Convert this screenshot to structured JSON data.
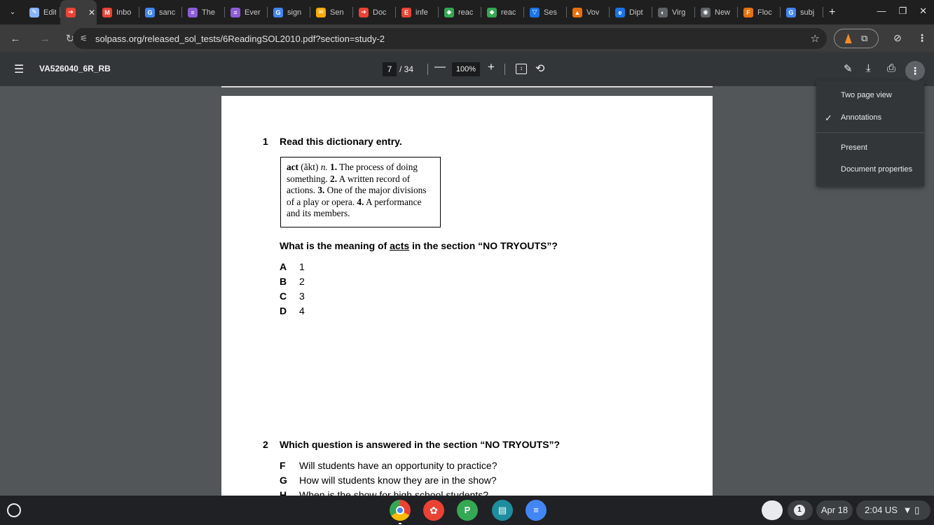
{
  "tabs": [
    {
      "label": "Edit",
      "fav_color": "#8ab4f8",
      "fav_text": "✎"
    },
    {
      "label": "",
      "fav_color": "#ea4335",
      "fav_text": "➔",
      "active": true
    },
    {
      "label": "Inbo",
      "fav_color": "#ea4335",
      "fav_text": "M"
    },
    {
      "label": "sanc",
      "fav_color": "#4285f4",
      "fav_text": "G"
    },
    {
      "label": "The",
      "fav_color": "#8e5cd9",
      "fav_text": "≡"
    },
    {
      "label": "Ever",
      "fav_color": "#8e5cd9",
      "fav_text": "≡"
    },
    {
      "label": "sign",
      "fav_color": "#4285f4",
      "fav_text": "G"
    },
    {
      "label": "Sen",
      "fav_color": "#f9ab00",
      "fav_text": "✉"
    },
    {
      "label": "Doc",
      "fav_color": "#ea4335",
      "fav_text": "➔"
    },
    {
      "label": "infe",
      "fav_color": "#ea4335",
      "fav_text": "E"
    },
    {
      "label": "reac",
      "fav_color": "#34a853",
      "fav_text": "◆"
    },
    {
      "label": "reac",
      "fav_color": "#34a853",
      "fav_text": "◆"
    },
    {
      "label": "Ses",
      "fav_color": "#1a73e8",
      "fav_text": "▽"
    },
    {
      "label": "Vov",
      "fav_color": "#e8710a",
      "fav_text": "▲"
    },
    {
      "label": "Dipt",
      "fav_color": "#1a73e8",
      "fav_text": "e"
    },
    {
      "label": "Virg",
      "fav_color": "#5f6368",
      "fav_text": "◐"
    },
    {
      "label": "New",
      "fav_color": "#5f6368",
      "fav_text": "◉"
    },
    {
      "label": "Floc",
      "fav_color": "#e8710a",
      "fav_text": "F"
    },
    {
      "label": "subj",
      "fav_color": "#4285f4",
      "fav_text": "G"
    }
  ],
  "address": {
    "url": "solpass.org/released_sol_tests/6ReadingSOL2010.pdf?section=study-2"
  },
  "pdf": {
    "title": "VA526040_6R_RB",
    "page_current": "7",
    "page_total": "/ 34",
    "zoom": "100%"
  },
  "menu": {
    "two_page_view": "Two page view",
    "annotations": "Annotations",
    "present": "Present",
    "document_properties": "Document properties"
  },
  "doc": {
    "q1_num": "1",
    "q1_text": "Read this dictionary entry.",
    "dict": {
      "word": "act",
      "pron": " (ăkt) ",
      "pos": "n.",
      "d1_num": " 1.",
      "d1": " The process of doing something.",
      "d2_num": " 2.",
      "d2": " A written record of actions.",
      "d3_num": " 3.",
      "d3": " One of the major divisions of a play or opera.",
      "d4_num": " 4.",
      "d4": " A performance and its members."
    },
    "q1b_pre": "What is the meaning of ",
    "q1b_word": "acts",
    "q1b_post": " in the section “NO TRYOUTS”?",
    "q1_options": [
      {
        "letter": "A",
        "text": "1"
      },
      {
        "letter": "B",
        "text": "2"
      },
      {
        "letter": "C",
        "text": "3"
      },
      {
        "letter": "D",
        "text": "4"
      }
    ],
    "q2_num": "2",
    "q2_text": "Which question is answered in the section “NO TRYOUTS”?",
    "q2_options": [
      {
        "letter": "F",
        "text": "Will students have an opportunity to practice?"
      },
      {
        "letter": "G",
        "text": "How will students know they are in the show?"
      },
      {
        "letter": "H",
        "text": "When is the show for high school students?"
      }
    ]
  },
  "shelf": {
    "date": "Apr 18",
    "time_status": "2:04 US",
    "notif_count": "1"
  }
}
